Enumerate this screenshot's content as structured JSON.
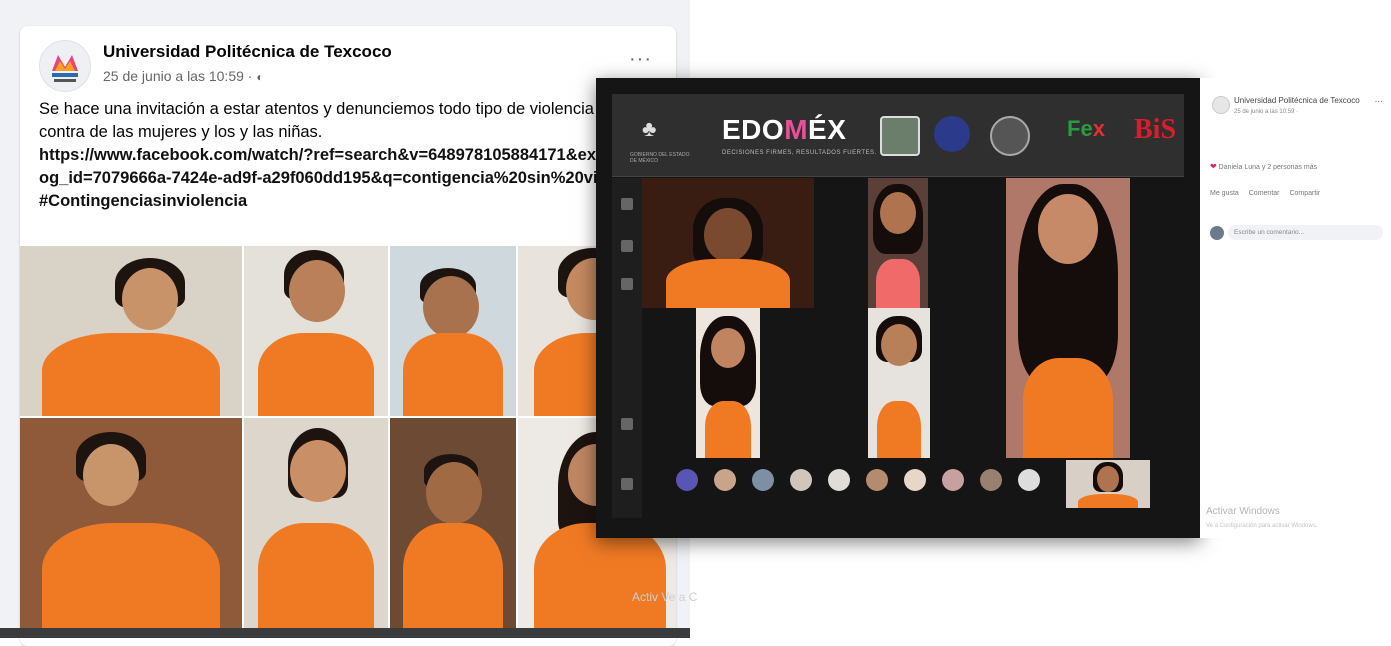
{
  "post": {
    "page_name": "Universidad Politécnica de Texcoco",
    "timestamp": "25 de junio a las 10:59 ·",
    "privacy_icon": "globe-icon",
    "more_icon": "ellipsis-icon",
    "more_label": "···",
    "text_intro": "Se hace una invitación a estar atentos y denunciemos todo tipo de violencia en contra de las mujeres y los y las niñas.",
    "link": "https://www.facebook.com/watch/?ref=search&v=648978105884171&external_log_id=7079666a-7424e-ad9f-a29f060dd195&q=contigencia%20sin%20violencia",
    "hashtag": "#Contingenciasinviolencia",
    "photo_count": 8
  },
  "video_call": {
    "banner": {
      "gov_label": "GOBIERNO DEL ESTADO DE MÉXICO",
      "brand_left": "EDO",
      "brand_m": "M",
      "brand_right": "ÉX",
      "brand_sub": "DECISIONES FIRMES, RESULTADOS FUERTES.",
      "logo_ex_1": "Fe",
      "logo_ex_2": "x",
      "logo_bis": "BiS"
    },
    "participant_count": 11
  },
  "mini_post": {
    "page_name": "Universidad Politécnica de Texcoco",
    "date": "25 de junio a las 10:59 · ",
    "reactions": "Daniela Luna y 2 personas más",
    "actions": [
      "Me gusta",
      "Comentar",
      "Compartir"
    ],
    "comment_placeholder": "Escribe un comentario...",
    "windows_title": "Activar Windows",
    "windows_sub": "Ve a Configuración para activar Windows."
  },
  "watermark_left": "Activ Ve a C",
  "colors": {
    "accent_orange": "#f07a24",
    "fb_text": "#050505",
    "fb_meta": "#65676b"
  }
}
